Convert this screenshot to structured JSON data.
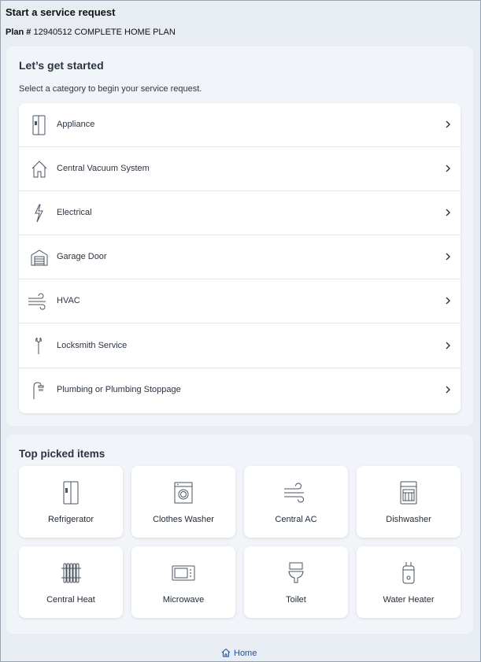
{
  "header": {
    "title": "Start a service request",
    "plan_label": "Plan #",
    "plan_value": "12940512 COMPLETE HOME PLAN"
  },
  "start": {
    "heading": "Let’s get started",
    "subheading": "Select a category to begin your service request.",
    "categories": [
      {
        "label": "Appliance",
        "icon": "refrigerator-icon"
      },
      {
        "label": "Central Vacuum System",
        "icon": "house-icon"
      },
      {
        "label": "Electrical",
        "icon": "lightning-icon"
      },
      {
        "label": "Garage Door",
        "icon": "garage-icon"
      },
      {
        "label": "HVAC",
        "icon": "wind-icon"
      },
      {
        "label": "Locksmith Service",
        "icon": "wrench-icon"
      },
      {
        "label": "Plumbing or Plumbing Stoppage",
        "icon": "shower-icon"
      }
    ]
  },
  "top_picked": {
    "heading": "Top picked items",
    "items": [
      {
        "label": "Refrigerator",
        "icon": "refrigerator-icon"
      },
      {
        "label": "Clothes Washer",
        "icon": "washer-icon"
      },
      {
        "label": "Central AC",
        "icon": "wind-icon"
      },
      {
        "label": "Dishwasher",
        "icon": "dishwasher-icon"
      },
      {
        "label": "Central Heat",
        "icon": "radiator-icon"
      },
      {
        "label": "Microwave",
        "icon": "microwave-icon"
      },
      {
        "label": "Toilet",
        "icon": "toilet-icon"
      },
      {
        "label": "Water Heater",
        "icon": "water-heater-icon"
      }
    ]
  },
  "footer": {
    "home_label": "Home"
  },
  "colors": {
    "background": "#e8edf3",
    "card": "#f1f4f8",
    "link": "#1d4e9e"
  }
}
